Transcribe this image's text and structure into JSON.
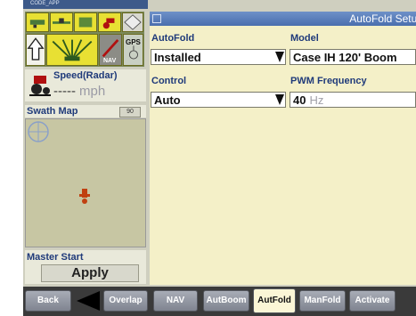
{
  "app": {
    "label": "CODE_APP"
  },
  "left": {
    "gps_label": "GPS",
    "nav_label": "NAV",
    "speed": {
      "label": "Speed(Radar)",
      "value": "-----",
      "unit": "mph"
    },
    "swath_map": {
      "title": "Swath Map",
      "badge": "90"
    },
    "master_start": {
      "title": "Master Start",
      "button": "Apply"
    }
  },
  "panel": {
    "title": "AutoFold Setup",
    "autofold": {
      "label": "AutoFold",
      "value": "Installed"
    },
    "model": {
      "label": "Model",
      "value": "Case IH 120' Boom"
    },
    "control": {
      "label": "Control",
      "value": "Auto"
    },
    "pwm": {
      "label": "PWM Frequency",
      "value": "40",
      "unit": "Hz"
    }
  },
  "nav": {
    "back": "Back",
    "overlap": "Overlap",
    "nav": "NAV",
    "autboom": "AutBoom",
    "autfold": "AutFold",
    "manfold": "ManFold",
    "activate": "Activate"
  },
  "colors": {
    "accent": "#1f3a7a",
    "titlebar": "#4a6fae",
    "panel_bg": "#f4f0c8",
    "icon_yellow": "#e8e033"
  }
}
